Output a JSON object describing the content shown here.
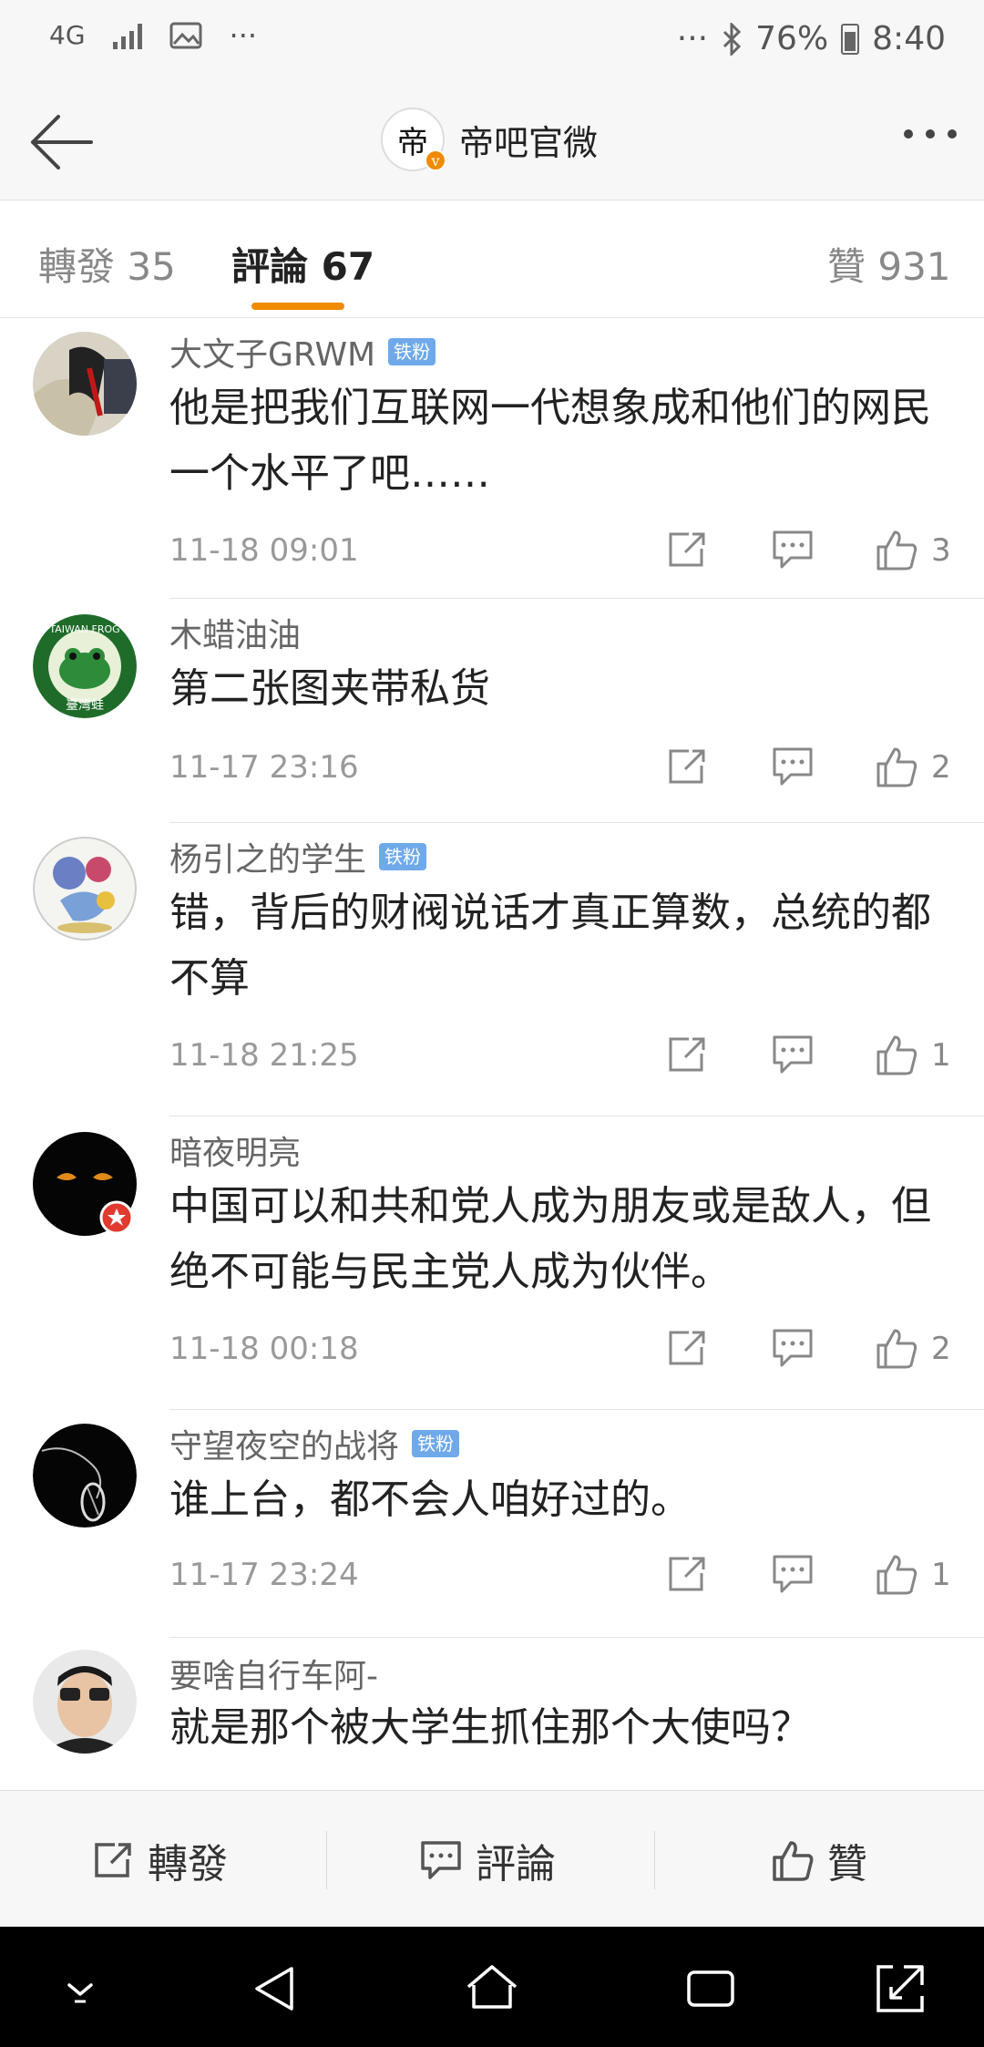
{
  "status_bar": {
    "network": "4G",
    "battery": "76%",
    "time": "8:40",
    "left_more": "···",
    "right_more": "···"
  },
  "header": {
    "account_name": "帝吧官微",
    "avatar_glyph": "帝"
  },
  "tabs": [
    {
      "label": "轉發 35"
    },
    {
      "label": "評論 67"
    },
    {
      "label": "贊 931"
    }
  ],
  "fan_badge": "铁粉",
  "comments": [
    {
      "user": "大文子GRWM",
      "fan": true,
      "text": "他是把我们互联网一代想象成和他们的网民一个水平了吧……",
      "time": "11-18 09:01",
      "likes": "3"
    },
    {
      "user": "木蜡油油",
      "fan": false,
      "text": "第二张图夹带私货",
      "time": "11-17 23:16",
      "likes": "2"
    },
    {
      "user": "杨引之的学生",
      "fan": true,
      "text": "错，背后的财阀说话才真正算数，总统的都不算",
      "time": "11-18 21:25",
      "likes": "1"
    },
    {
      "user": "暗夜明亮",
      "fan": false,
      "text": "中国可以和共和党人成为朋友或是敌人，但绝不可能与民主党人成为伙伴。",
      "time": "11-18 00:18",
      "likes": "2"
    },
    {
      "user": "守望夜空的战将",
      "fan": true,
      "text": "谁上台，都不会人咱好过的。",
      "time": "11-17 23:24",
      "likes": "1"
    },
    {
      "user": "要啥自行车阿-",
      "fan": false,
      "text": "就是那个被大学生抓住那个大使吗？",
      "time": "",
      "likes": ""
    }
  ],
  "avatar_texts": {
    "frog_top": "TAIWAN FROG",
    "frog_bottom": "臺灣蛙"
  },
  "action_bar": {
    "repost": "轉發",
    "comment": "評論",
    "like": "贊"
  },
  "colors": {
    "accent": "#f08a00",
    "fan_badge": "#6fa9ea"
  }
}
